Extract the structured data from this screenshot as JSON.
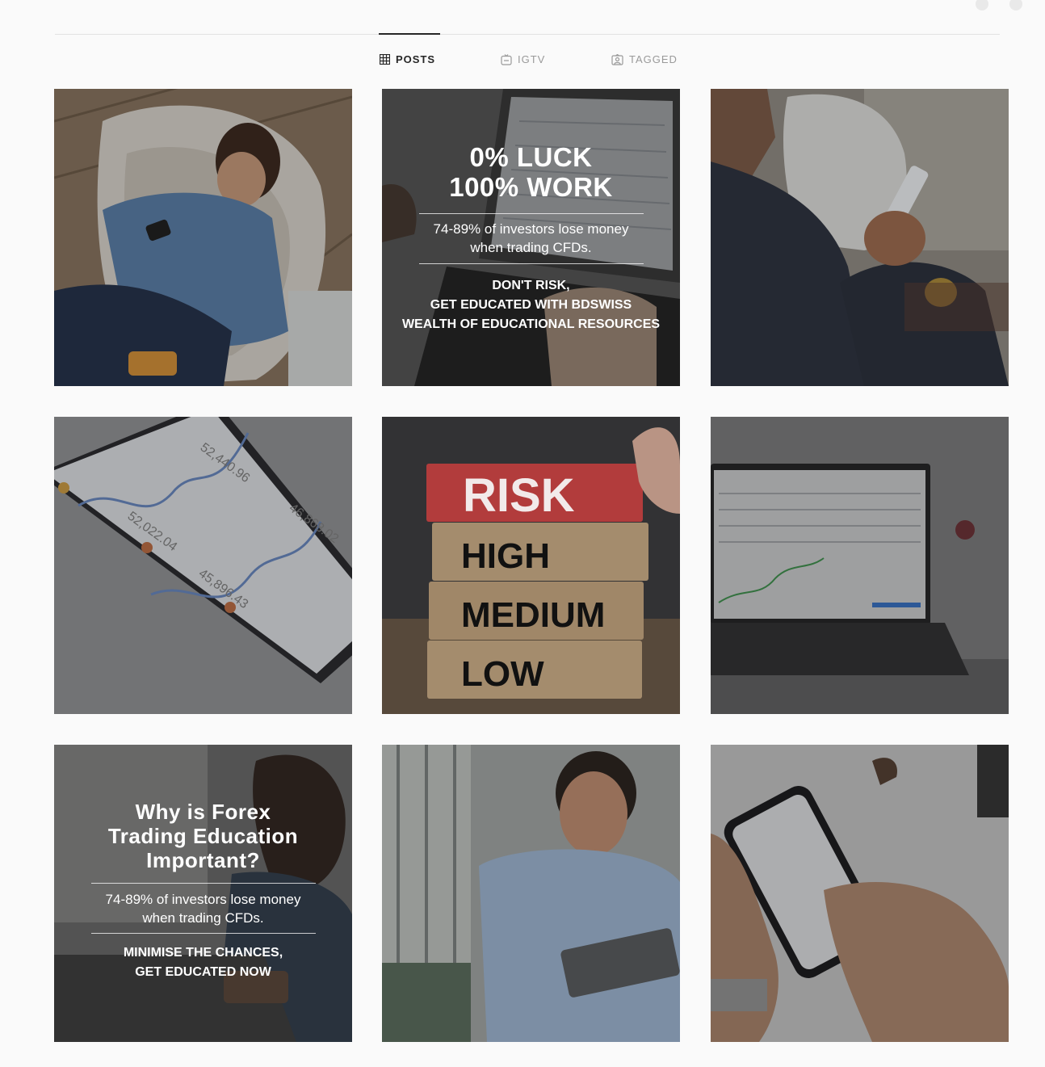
{
  "tabs": {
    "posts": "POSTS",
    "igtv": "IGTV",
    "tagged": "TAGGED"
  },
  "icons": {
    "posts": "grid-icon",
    "igtv": "tv-icon",
    "tagged": "tagged-icon"
  },
  "posts": {
    "post2": {
      "headline_line1": "0% LUCK",
      "headline_line2": "100% WORK",
      "disclaimer_line1": "74-89% of investors lose money",
      "disclaimer_line2": "when trading CFDs.",
      "cta_line1": "DON'T RISK,",
      "cta_line2": "GET EDUCATED WITH BDSWISS",
      "cta_line3": "WEALTH OF EDUCATIONAL RESOURCES"
    },
    "post5": {
      "block1": "RISK",
      "block2": "HIGH",
      "block3": "MEDIUM",
      "block4": "LOW"
    },
    "post7": {
      "headline_line1": "Why is Forex",
      "headline_line2": "Trading Education",
      "headline_line3": "Important?",
      "disclaimer_line1": "74-89% of investors lose money",
      "disclaimer_line2": "when trading CFDs.",
      "cta_line1": "MINIMISE THE CHANCES,",
      "cta_line2": "GET EDUCATED NOW"
    }
  },
  "colors": {
    "active_tab": "#262626",
    "inactive_tab": "#9a9a9a",
    "risk_block": "#d94a4a",
    "wood_block": "#c9ab86"
  }
}
